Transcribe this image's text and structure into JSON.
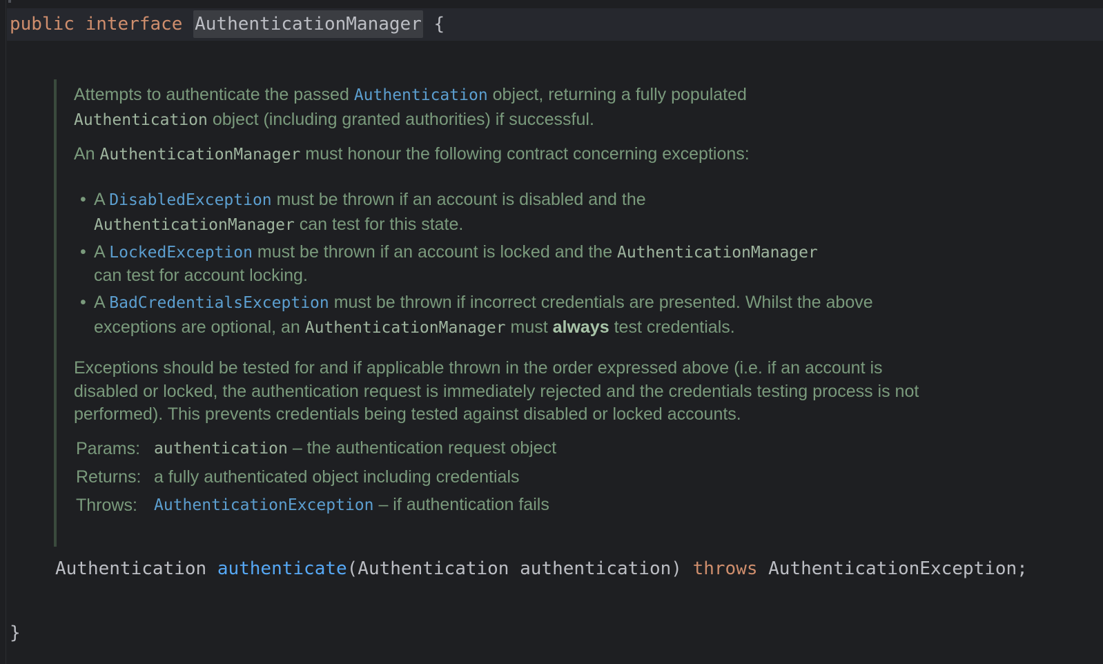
{
  "code": {
    "line1": {
      "kw_public": "public",
      "kw_interface": "interface",
      "name": "AuthenticationManager",
      "brace": "{"
    },
    "signature": {
      "return_type": "Authentication",
      "method": "authenticate",
      "params": "(Authentication authentication)",
      "kw_throws": "throws",
      "exception": "AuthenticationException;"
    },
    "closing_brace": "}"
  },
  "javadoc": {
    "p1": {
      "t1": "Attempts to authenticate the passed ",
      "link1": "Authentication",
      "t2": " object, returning a fully populated ",
      "code1": "Authentication",
      "t3": " object (including granted authorities) if successful."
    },
    "p2": {
      "t1": "An ",
      "code1": "AuthenticationManager",
      "t2": " must honour the following contract concerning exceptions:"
    },
    "bullets": [
      {
        "dot": "•",
        "t1": "A ",
        "link": "DisabledException",
        "t2": " must be thrown if an account is disabled and the ",
        "code": "AuthenticationManager",
        "t3": " can test for this state."
      },
      {
        "dot": "•",
        "t1": "A ",
        "link": "LockedException",
        "t2": " must be thrown if an account is locked and the ",
        "code": "AuthenticationManager",
        "t3": " can test for account locking."
      },
      {
        "dot": "•",
        "t1": "A ",
        "link": "BadCredentialsException",
        "t2": " must be thrown if incorrect credentials are presented. Whilst the above exceptions are optional, an ",
        "code": "AuthenticationManager",
        "t3": " must ",
        "bold": "always",
        "t4": " test credentials."
      }
    ],
    "p4": "Exceptions should be tested for and if applicable thrown in the order expressed above (i.e. if an account is disabled or locked, the authentication request is immediately rejected and the credentials testing process is not performed). This prevents credentials being tested against disabled or locked accounts.",
    "tags": {
      "params_label": "Params:",
      "params_name": "authentication",
      "params_desc": " – the authentication request object",
      "returns_label": "Returns:",
      "returns_desc": "a fully authenticated object including credentials",
      "throws_label": "Throws:",
      "throws_link": "AuthenticationException",
      "throws_desc": " – if authentication fails"
    }
  }
}
